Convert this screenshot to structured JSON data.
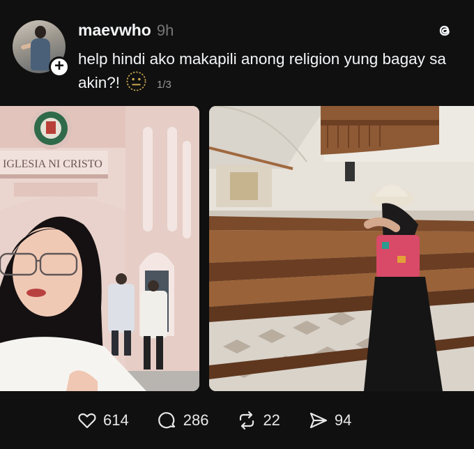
{
  "post": {
    "username": "maevwho",
    "time": "9h",
    "caption": "help hindi ako makapili anong religion yung bagay sa akin?!",
    "emoji": "neutral-face-emoji",
    "carousel_counter": "1/3",
    "follow_badge": "+",
    "images": [
      {
        "sign_text": "IGLESIA NI CRISTO",
        "icon": "church-facade-photo"
      },
      {
        "icon": "church-interior-photo"
      }
    ]
  },
  "actions": {
    "likes": "614",
    "replies": "286",
    "reposts": "22",
    "shares": "94"
  },
  "colors": {
    "background": "#101010",
    "text": "#f3f5f7",
    "muted": "#777777"
  }
}
